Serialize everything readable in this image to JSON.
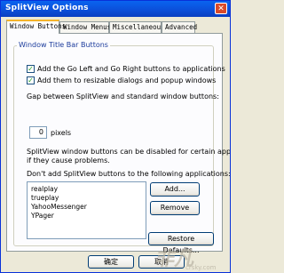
{
  "window": {
    "title": "SplitView Options",
    "close_glyph": "✕"
  },
  "tabs": [
    {
      "label": "Window Buttons",
      "active": true
    },
    {
      "label": "Window Menus",
      "active": false
    },
    {
      "label": "Miscellaneous",
      "active": false
    },
    {
      "label": "Advanced",
      "active": false
    }
  ],
  "group": {
    "legend": "Window Title Bar Buttons",
    "checkbox1_label": "Add the Go Left and Go Right buttons to applications",
    "checkbox1_checked": true,
    "checkbox2_label": "Add them to resizable dialogs and popup windows",
    "checkbox2_checked": true,
    "gap_label": "Gap between SplitView and standard window buttons:",
    "gap_value": "0",
    "gap_unit": "pixels",
    "info_line1": "SplitView window buttons can be disabled for certain applications",
    "info_line2": "if they cause problems.",
    "exclude_label": "Don't add SplitView buttons to the following applications:",
    "apps": [
      "realplay",
      "trueplay",
      "YahooMessenger",
      "YPager"
    ],
    "add_label": "Add...",
    "remove_label": "Remove"
  },
  "restore_label": "Restore Defaults...",
  "ok_label": "确定",
  "cancel_label": "取消",
  "watermark": "非凡",
  "watermark_url": "crsky.com",
  "colors": {
    "titlebar": "#0b4ed8",
    "legend": "#1c3c9c",
    "active_tab_accent": "#f4b32a",
    "check": "#21a121"
  }
}
